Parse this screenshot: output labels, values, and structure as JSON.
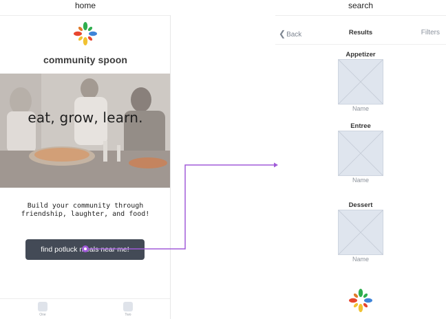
{
  "screens": {
    "home": {
      "label": "home",
      "brand": "community spoon",
      "hero_text": "eat, grow, learn.",
      "tagline": "Build your community through\nfriendship, laughter, and food!",
      "cta_label": "find potluck meals near me!",
      "tabs": [
        {
          "label": "One"
        },
        {
          "label": "Two"
        }
      ]
    },
    "search": {
      "label": "search",
      "nav": {
        "back": "Back",
        "title": "Results",
        "filters": "Filters"
      },
      "categories": [
        {
          "title": "Appetizer",
          "name": "Name"
        },
        {
          "title": "Entree",
          "name": "Name"
        },
        {
          "title": "Dessert",
          "name": "Name"
        }
      ]
    }
  },
  "colors": {
    "accent_flow": "#a05ad8",
    "button_bg": "#434a56",
    "placeholder_bg": "#dfe5ee"
  },
  "icons": [
    "logo-icon",
    "chevron-left-icon",
    "image-placeholder-icon",
    "tab-icon"
  ]
}
